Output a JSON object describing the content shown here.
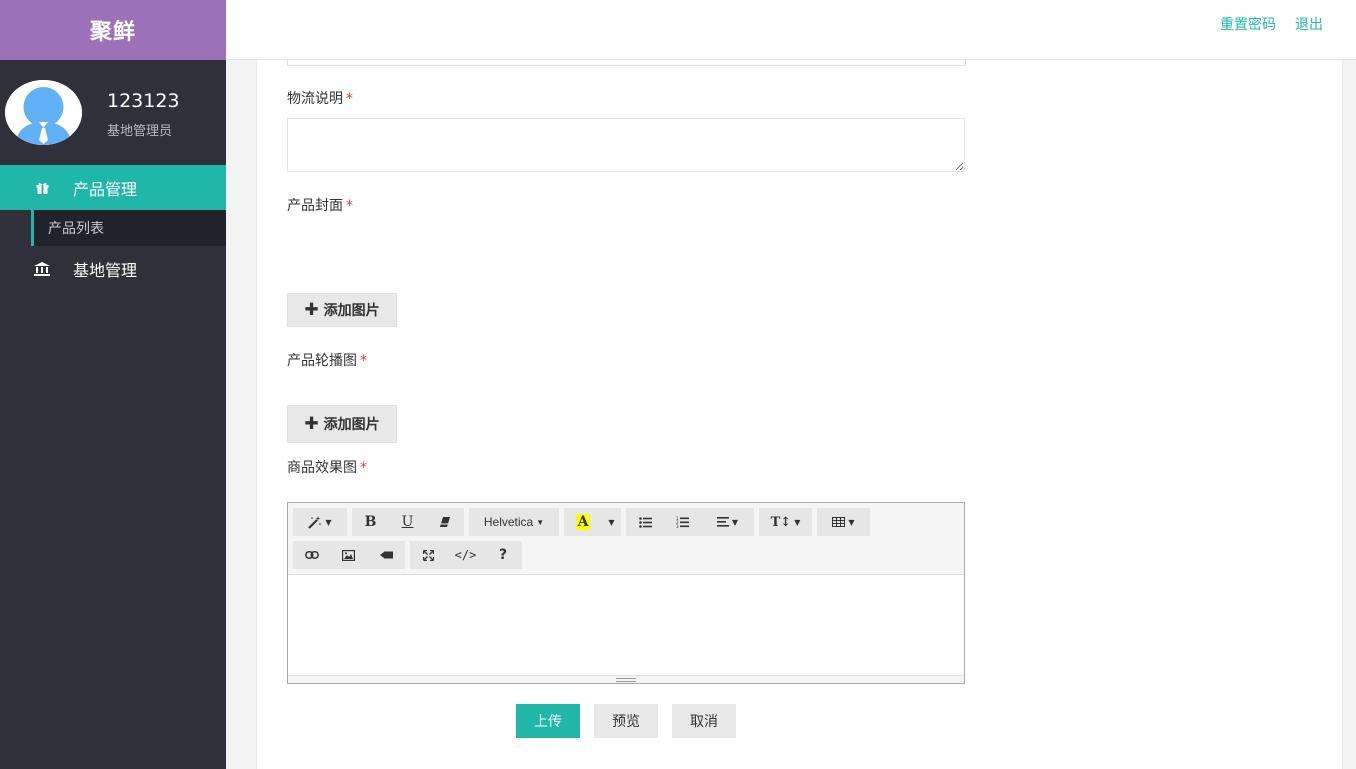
{
  "brand": "聚鲜",
  "user": {
    "name": "123123",
    "role": "基地管理员"
  },
  "nav": {
    "product": "产品管理",
    "product_list": "产品列表",
    "base": "基地管理"
  },
  "topbar": {
    "reset_password": "重置密码",
    "logout": "退出"
  },
  "form": {
    "logistics_label": "物流说明",
    "logistics_value": "",
    "cover_label": "产品封面",
    "carousel_label": "产品轮播图",
    "effect_label": "商品效果图",
    "required_mark": "*",
    "add_image_label": "添加图片",
    "add_image_icon": "plus-icon"
  },
  "editor": {
    "font_name": "Helvetica",
    "toolbar_icons": [
      "magic-icon",
      "bold-icon",
      "underline-icon",
      "eraser-icon",
      "font-color-icon",
      "unordered-list-icon",
      "ordered-list-icon",
      "align-icon",
      "line-height-icon",
      "table-icon",
      "link-icon",
      "picture-icon",
      "video-icon",
      "fullscreen-icon",
      "code-icon",
      "help-icon"
    ],
    "highlight_color": "#ffff00"
  },
  "actions": {
    "upload": "上传",
    "preview": "预览",
    "cancel": "取消"
  },
  "colors": {
    "brand": "#9b72b9",
    "accent": "#21b7a8",
    "sidebar": "#2f3039",
    "required": "#e4393c"
  }
}
